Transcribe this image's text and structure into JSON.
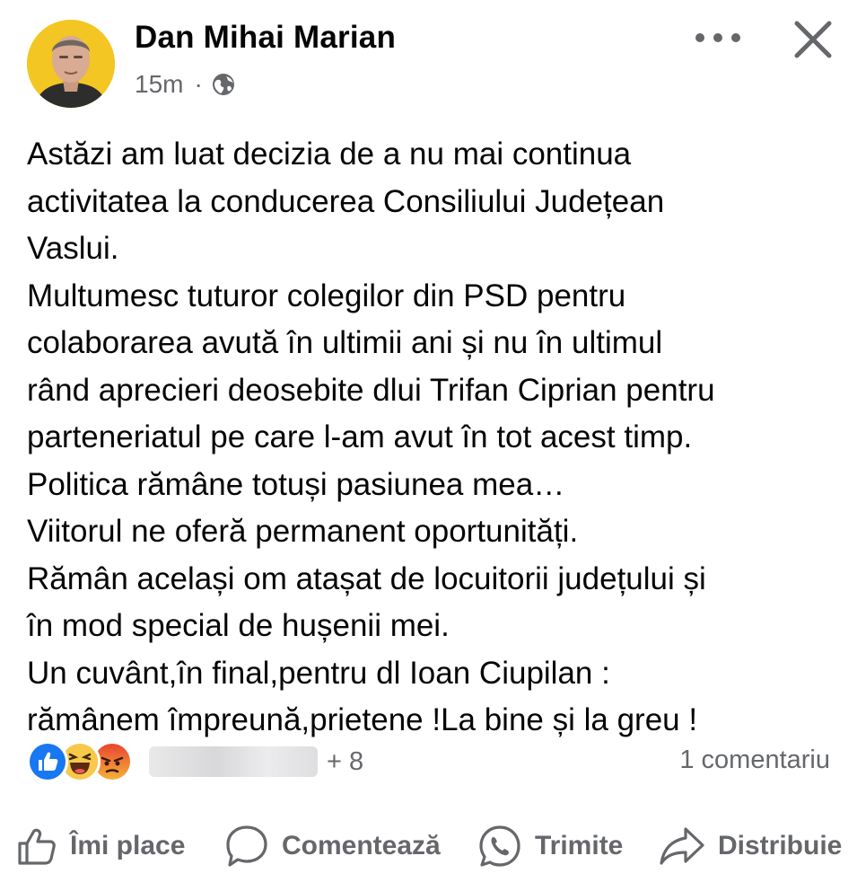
{
  "post": {
    "author": "Dan Mihai Marian",
    "time": "15m",
    "separator": "·",
    "audience_icon": "globe-icon",
    "text_lines": [
      "Astăzi am luat decizia de a nu mai continua",
      "activitatea la conducerea Consiliului Județean",
      "Vaslui.",
      "Multumesc tuturor colegilor din PSD pentru",
      "colaborarea avută în ultimii ani și nu în ultimul",
      "rând aprecieri deosebite dlui Trifan Ciprian pentru",
      "parteneriatul pe care l-am avut în tot acest timp.",
      "Politica rămâne totuși pasiunea mea…",
      "Viitorul ne oferă permanent oportunități.",
      "Rămân același om atașat de locuitorii județului și",
      "în mod special de hușenii mei.",
      "Un cuvânt,în final,pentru dl Ioan Ciupilan :",
      "rămânem împreună,prietene !La bine și la greu !"
    ]
  },
  "reactions": {
    "icons": [
      "like-reaction-icon",
      "haha-reaction-icon",
      "angry-reaction-icon"
    ],
    "extra_count": "+ 8",
    "comments": "1 comentariu"
  },
  "actions": {
    "like": "Îmi place",
    "comment": "Comentează",
    "send": "Trimite",
    "share": "Distribuie"
  },
  "colors": {
    "text": "#050505",
    "secondary": "#65676b",
    "like_blue": "#1877f2",
    "angry_red": "#e9710f",
    "avatar_bg": "#f3c623"
  }
}
